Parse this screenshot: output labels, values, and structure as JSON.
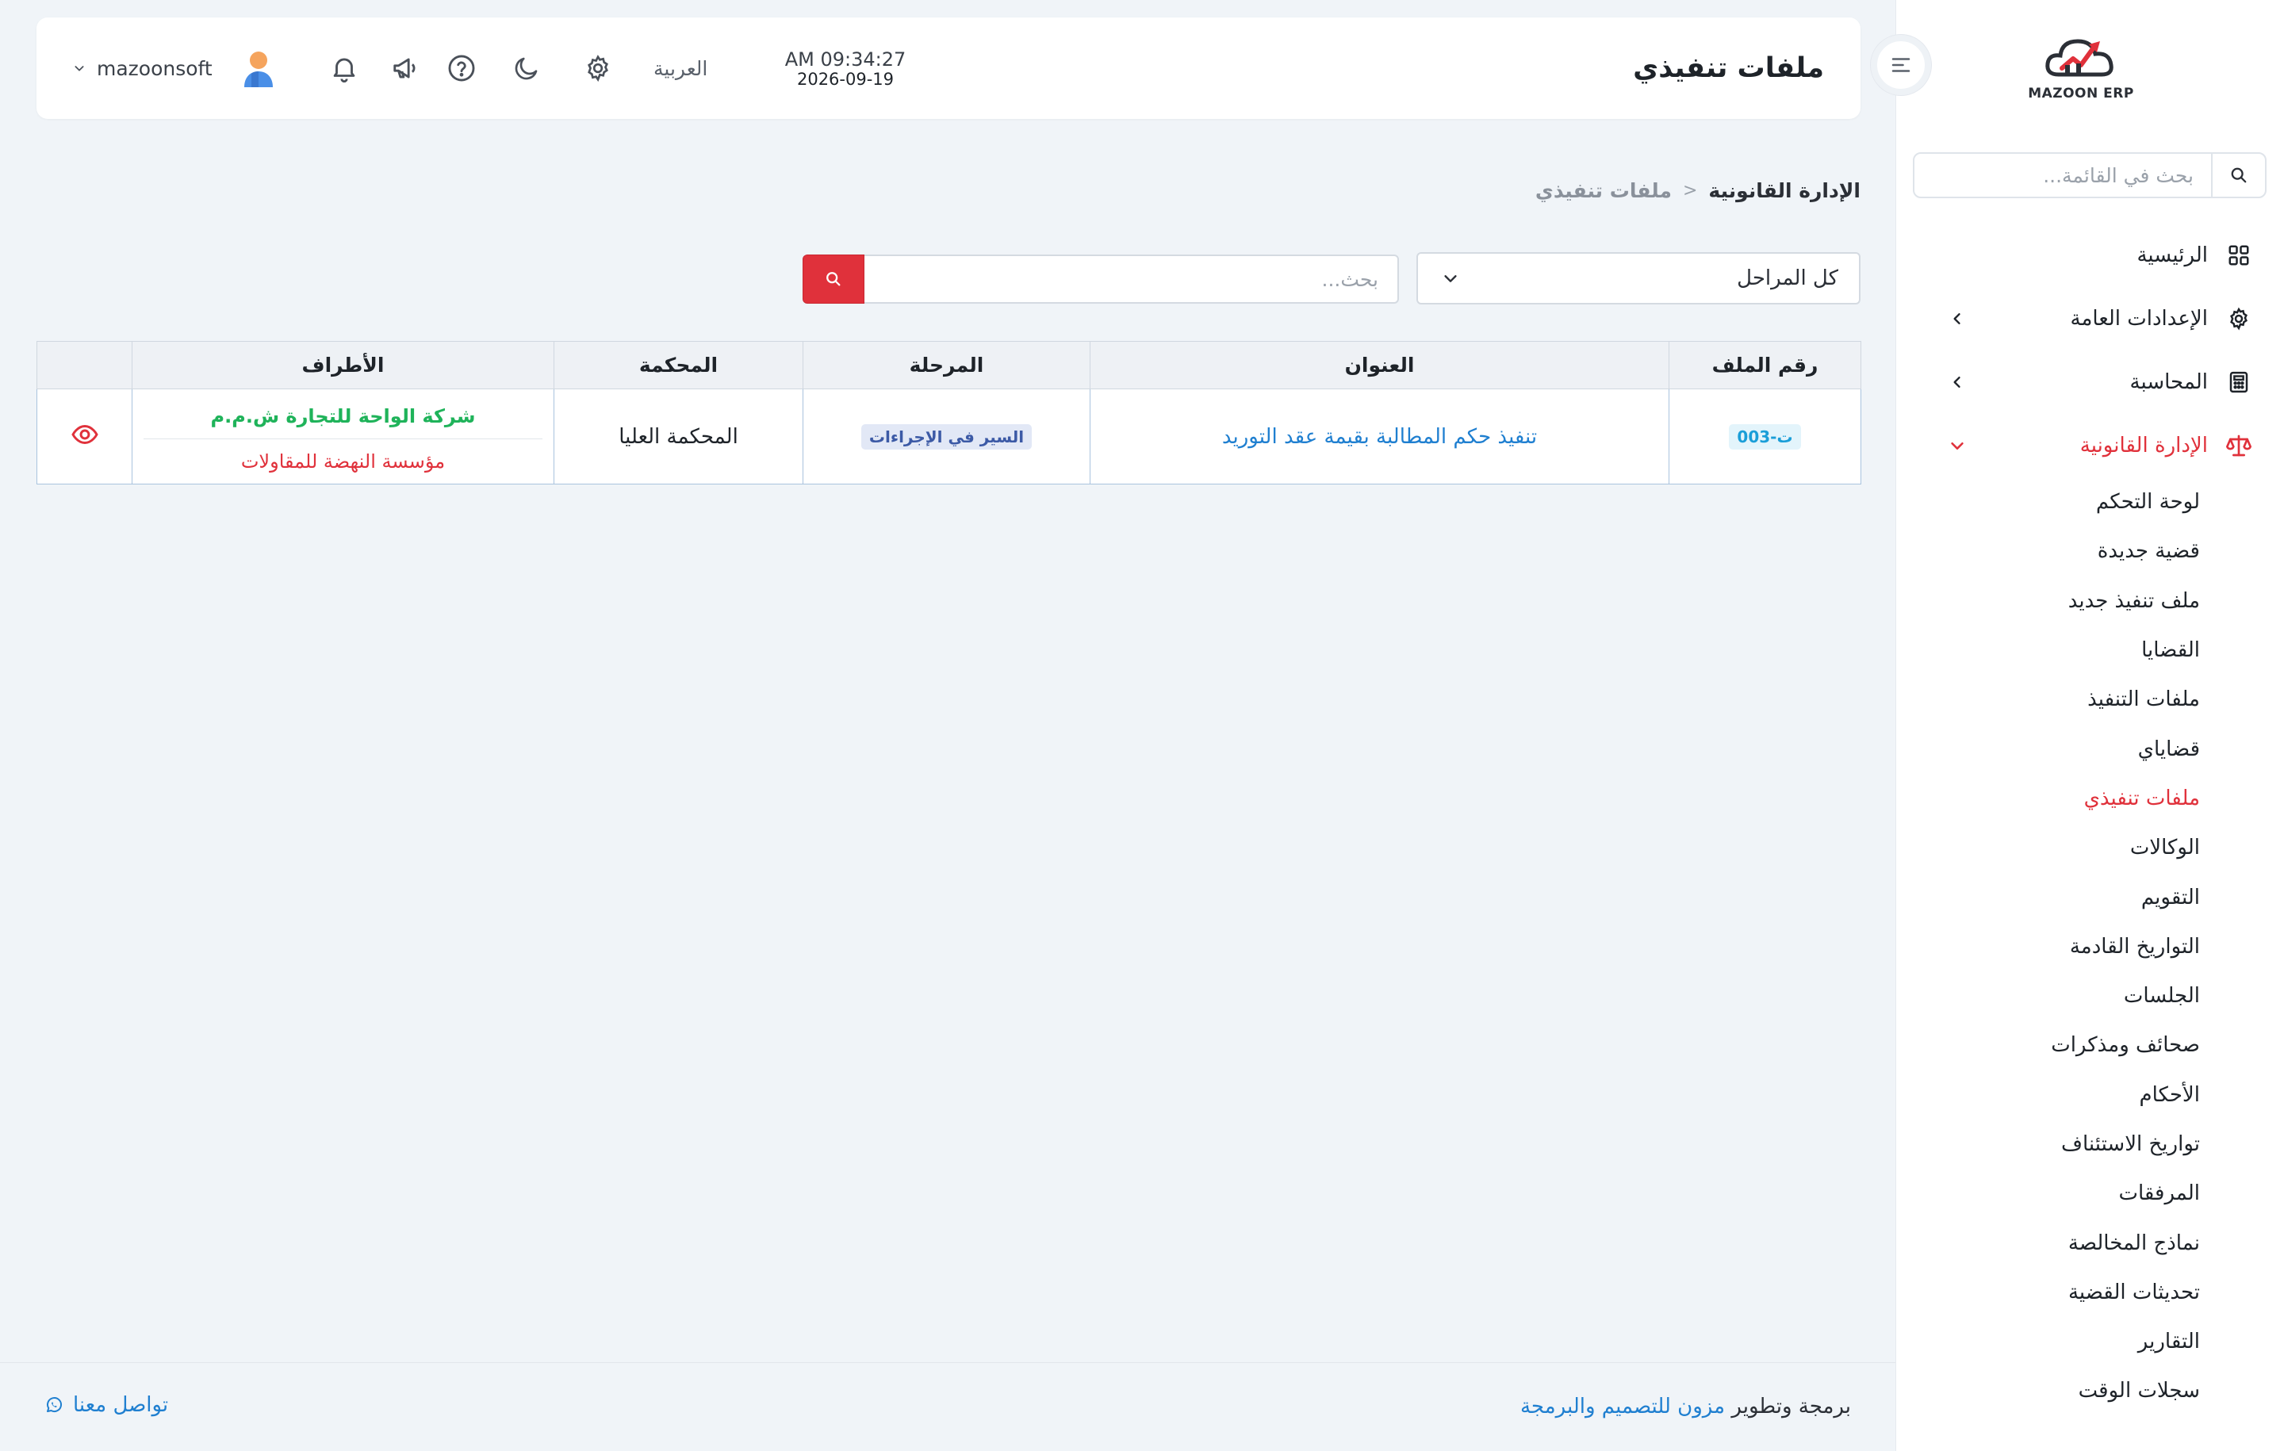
{
  "colors": {
    "accent": "#e0313b",
    "link": "#1f7fd0",
    "success": "#1fb35a",
    "background": "#f0f4f8"
  },
  "brand": {
    "logo_text": "MAZOON ERP",
    "logo_icon": "cloud-chart-logo"
  },
  "sidebar": {
    "search_placeholder": "بحث في القائمة...",
    "items": [
      {
        "label": "الرئيسية",
        "icon": "grid-icon"
      },
      {
        "label": "الإعدادات العامة",
        "icon": "gear-icon",
        "chevron": "chevron-left-icon"
      },
      {
        "label": "المحاسبة",
        "icon": "calculator-icon",
        "chevron": "chevron-left-icon"
      },
      {
        "label": "الإدارة القانونية",
        "icon": "scales-icon",
        "chevron": "chevron-down-icon",
        "active": true
      }
    ],
    "sub_items": [
      "لوحة التحكم",
      "قضية جديدة",
      "ملف تنفيذ جديد",
      "القضايا",
      "ملفات التنفيذ",
      "قضاياي",
      "ملفات تنفيذي",
      "الوكالات",
      "التقويم",
      "التواريخ القادمة",
      "الجلسات",
      "صحائف ومذكرات",
      "الأحكام",
      "تواريخ الاستئناف",
      "المرفقات",
      "نماذج المخالصة",
      "تحديثات القضية",
      "التقارير",
      "سجلات الوقت"
    ],
    "current_sub_item": "ملفات تنفيذي"
  },
  "header": {
    "title": "ملفات تنفيذي",
    "time": "AM 09:34:27",
    "date": "2026-09-19",
    "language": "العربية",
    "icons": [
      "gear-icon",
      "moon-icon",
      "help-icon",
      "megaphone-icon",
      "bell-icon"
    ],
    "username": "mazoonsoft"
  },
  "breadcrumb": {
    "parent": "الإدارة القانونية",
    "separator": "<",
    "current": "ملفات تنفيذي"
  },
  "filters": {
    "stage_selected": "كل المراحل",
    "search_placeholder": "بحث..."
  },
  "table": {
    "columns": [
      "رقم الملف",
      "العنوان",
      "المرحلة",
      "المحكمة",
      "الأطراف",
      ""
    ],
    "rows": [
      {
        "file_number": "ت-003",
        "title": "تنفيذ حكم المطالبة بقيمة عقد التوريد",
        "stage": "السير في الإجراءات",
        "court": "المحكمة العليا",
        "party_1": "شركة الواحة للتجارة ش.م.م",
        "party_2": "مؤسسة النهضة للمقاولات",
        "action_icon": "eye-icon"
      }
    ]
  },
  "footer": {
    "credit_prefix": "برمجة وتطوير",
    "credit_link": "مزون للتصميم والبرمجة",
    "contact": "تواصل معنا",
    "contact_icon": "whatsapp-icon"
  }
}
